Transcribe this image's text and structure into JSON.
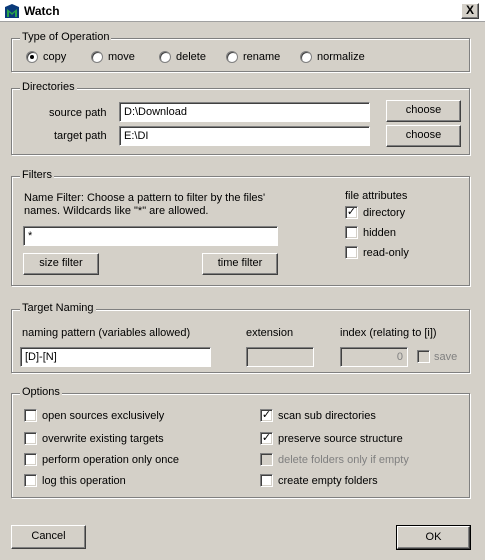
{
  "window": {
    "title": "Watch",
    "close_label": "X"
  },
  "operation": {
    "group_label": "Type of Operation",
    "options": [
      {
        "label": "copy",
        "selected": true
      },
      {
        "label": "move",
        "selected": false
      },
      {
        "label": "delete",
        "selected": false
      },
      {
        "label": "rename",
        "selected": false
      },
      {
        "label": "normalize",
        "selected": false
      }
    ]
  },
  "directories": {
    "group_label": "Directories",
    "source_label": "source path",
    "source_value": "D:\\Download",
    "target_label": "target path",
    "target_value": "E:\\DI",
    "choose_label": "choose"
  },
  "filters": {
    "group_label": "Filters",
    "name_filter_line1": "Name Filter: Choose a pattern to filter by the files'",
    "name_filter_line2": "names. Wildcards like \"*\" are allowed.",
    "pattern_value": "*",
    "size_filter_label": "size filter",
    "time_filter_label": "time filter",
    "attributes_label": "file attributes",
    "attributes": [
      {
        "label": "directory",
        "checked": true
      },
      {
        "label": "hidden",
        "checked": false
      },
      {
        "label": "read-only",
        "checked": false
      }
    ]
  },
  "target_naming": {
    "group_label": "Target Naming",
    "pattern_label": "naming pattern (variables allowed)",
    "pattern_value": "[D]-[N]",
    "extension_label": "extension",
    "extension_value": "",
    "index_label": "index (relating to [i])",
    "index_value": "0",
    "save_label": "save"
  },
  "options": {
    "group_label": "Options",
    "items": [
      {
        "label": "open sources exclusively",
        "checked": false,
        "enabled": true
      },
      {
        "label": "overwrite existing targets",
        "checked": false,
        "enabled": true
      },
      {
        "label": "perform operation only once",
        "checked": false,
        "enabled": true
      },
      {
        "label": "log this operation",
        "checked": false,
        "enabled": true
      },
      {
        "label": "scan sub directories",
        "checked": true,
        "enabled": true
      },
      {
        "label": "preserve source structure",
        "checked": true,
        "enabled": true
      },
      {
        "label": "delete folders only if empty",
        "checked": false,
        "enabled": false
      },
      {
        "label": "create empty folders",
        "checked": false,
        "enabled": true
      }
    ]
  },
  "footer": {
    "cancel_label": "Cancel",
    "ok_label": "OK"
  },
  "check_glyph": "✓"
}
